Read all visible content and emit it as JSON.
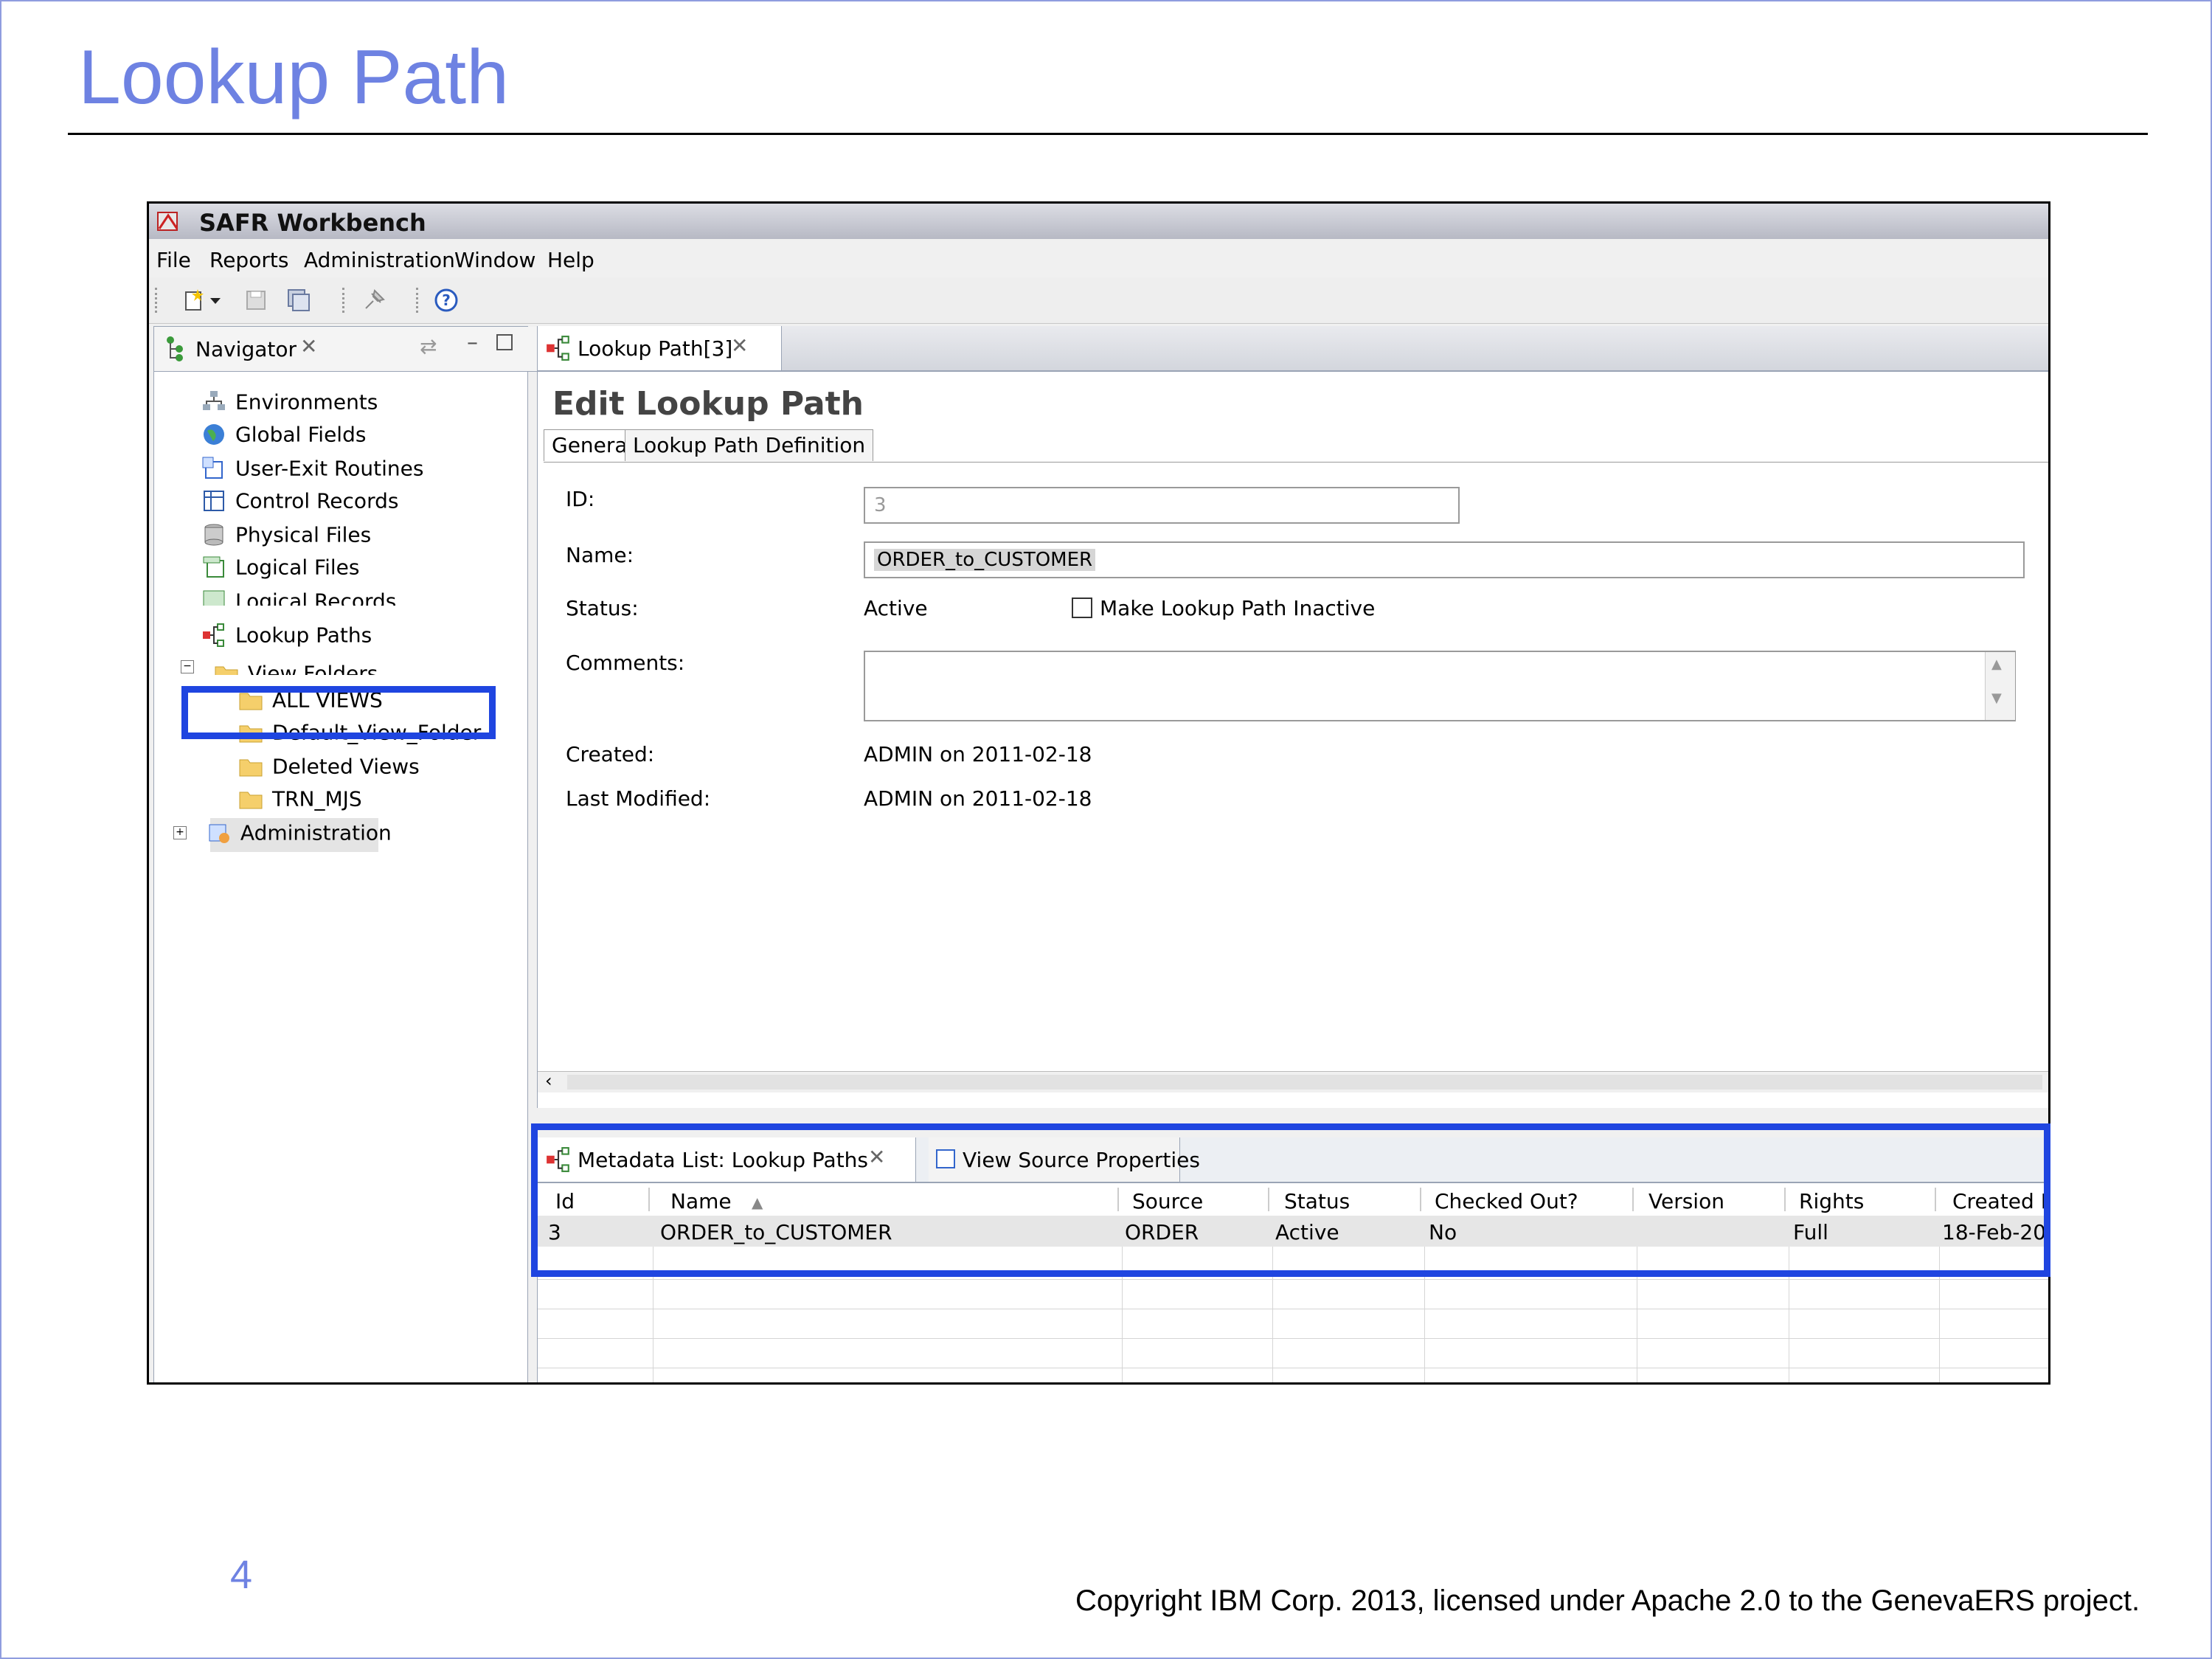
{
  "slide": {
    "title": "Lookup Path",
    "page_number": "4",
    "copyright": "Copyright IBM Corp. 2013, licensed under Apache 2.0 to the GenevaERS project."
  },
  "app": {
    "title": "SAFR Workbench",
    "menu": [
      "File",
      "Reports",
      "Administration",
      "Window",
      "Help"
    ],
    "toolbar_icons": [
      "new-icon",
      "dropdown-arrow-icon",
      "save-icon",
      "save-all-icon",
      "pin-icon",
      "help-icon"
    ]
  },
  "navigator": {
    "tab_label": "Navigator",
    "items": [
      {
        "label": "Environments",
        "icon": "environments-icon"
      },
      {
        "label": "Global Fields",
        "icon": "globe-icon"
      },
      {
        "label": "User-Exit Routines",
        "icon": "user-exit-icon"
      },
      {
        "label": "Control Records",
        "icon": "table-icon"
      },
      {
        "label": "Physical Files",
        "icon": "database-icon"
      },
      {
        "label": "Logical Files",
        "icon": "logical-file-icon"
      },
      {
        "label": "Logical Records",
        "icon": "logical-record-icon"
      },
      {
        "label": "Lookup Paths",
        "icon": "lookup-path-icon"
      },
      {
        "label": "View Folders",
        "icon": "folder-icon"
      },
      {
        "label": "ALL VIEWS",
        "icon": "folder-icon"
      },
      {
        "label": "Default_View_Folder",
        "icon": "folder-icon"
      },
      {
        "label": "Deleted Views",
        "icon": "folder-icon"
      },
      {
        "label": "TRN_MJS",
        "icon": "folder-icon"
      },
      {
        "label": "Administration",
        "icon": "administration-icon"
      }
    ],
    "selected": "Lookup Paths"
  },
  "editor": {
    "tab_label": "Lookup Path[3]",
    "heading": "Edit Lookup Path",
    "subtabs": [
      "General",
      "Lookup Path Definition"
    ],
    "fields": {
      "id_label": "ID:",
      "id_value": "3",
      "name_label": "Name:",
      "name_value": "ORDER_to_CUSTOMER",
      "status_label": "Status:",
      "status_value": "Active",
      "inactive_checkbox_label": "Make Lookup Path Inactive",
      "inactive_checked": false,
      "comments_label": "Comments:",
      "comments_value": "",
      "created_label": "Created:",
      "created_value": "ADMIN on 2011-02-18",
      "modified_label": "Last Modified:",
      "modified_value": "ADMIN on 2011-02-18"
    }
  },
  "metadata_list": {
    "tabs": [
      "Metadata List: Lookup Paths",
      "View Source Properties"
    ],
    "columns": [
      "Id",
      "Name",
      "Source",
      "Status",
      "Checked Out?",
      "Version",
      "Rights",
      "Created D"
    ],
    "sort_column": "Name",
    "rows": [
      [
        "3",
        "ORDER_to_CUSTOMER",
        "ORDER",
        "Active",
        "No",
        "",
        "Full",
        "18-Feb-20"
      ]
    ]
  },
  "colors": {
    "title_blue": "#6e82e2",
    "highlight_blue": "#1f45e0"
  }
}
